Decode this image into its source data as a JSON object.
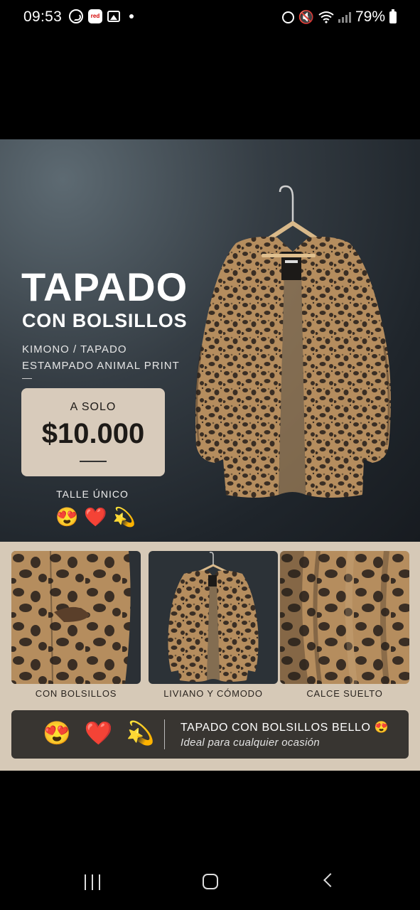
{
  "status_bar": {
    "time": "09:53",
    "battery": "79%",
    "red_badge": "red\nmob"
  },
  "hero": {
    "title": "TAPADO",
    "subtitle": "CON BOLSILLOS",
    "desc_line1": "KIMONO / TAPADO",
    "desc_line2": "ESTAMPADO ANIMAL PRINT",
    "price_label": "A SOLO",
    "price": "$10.000",
    "size": "TALLE ÚNICO",
    "emojis": [
      "😍",
      "❤️",
      "💫"
    ]
  },
  "features": [
    {
      "caption": "CON BOLSILLOS",
      "icon": "pocket-closeup-photo"
    },
    {
      "caption": "LIVIANO Y CÓMODO",
      "icon": "kimono-on-hanger-photo"
    },
    {
      "caption": "CALCE SUELTO",
      "icon": "fabric-drape-photo"
    }
  ],
  "banner": {
    "emojis": [
      "😍",
      "❤️",
      "💫"
    ],
    "headline": "TAPADO CON BOLSILLOS BELLO 😍",
    "tagline": "Ideal para cualquier ocasión"
  },
  "colors": {
    "hero_bg": "#2b3238",
    "panel_beige": "#d6c9b7",
    "price_box": "#d8cbbb",
    "banner_bg": "#383531",
    "leopard_base": "#b58d5e",
    "leopard_spot": "#3a2e24"
  },
  "nav": {
    "recent": "recent-apps-icon",
    "home": "home-icon",
    "back": "back-icon"
  }
}
